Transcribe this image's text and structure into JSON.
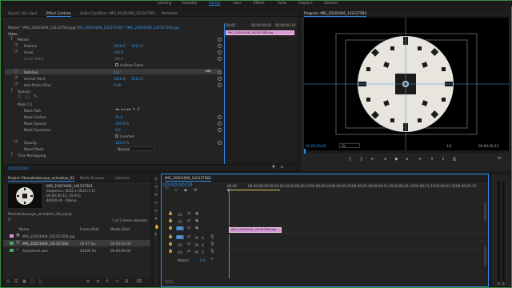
{
  "workspaces": [
    "Learning",
    "Assembly",
    "Editing",
    "Color",
    "Effects",
    "Audio",
    "Graphics",
    "Libraries"
  ],
  "active_workspace": "Editing",
  "source_panel": {
    "tabs": [
      "Source: (no clips)",
      "Effect Controls",
      "Audio Clip Mixer: IMG_20201006_142337583",
      "Metadata"
    ],
    "active_tab": "Effect Controls",
    "master_label": "Master * IMG_20201006_142337583.jpg",
    "sequence_label": "IMG_20201006_142337583 * IMG_20201006_142337583.jpg",
    "clip_label": "IMG_20201006_142337583.jpg",
    "ruler_times": [
      "00;00",
      "00;00;00;05",
      "00;00;00;10"
    ],
    "video_header": "Video",
    "motion": "Motion",
    "position_label": "Position",
    "position_x": "2016.0",
    "position_y": "1512.0",
    "scale_label": "Scale",
    "scale_value": "100.0",
    "scale_width_label": "Scale Width",
    "scale_width_value": "100.0",
    "uniform_scale": "Uniform Scale",
    "rotation_label": "Rotation",
    "rotation_value": "0.0 °",
    "anchor_label": "Anchor Point",
    "anchor_x": "2016.0",
    "anchor_y": "1512.0",
    "antiflicker_label": "Anti-flicker Filter",
    "antiflicker_value": "0.00",
    "opacity_header": "Opacity",
    "mask_label": "Mask (1)",
    "mask_path": "Mask Path",
    "mask_feather": "Mask Feather",
    "mask_feather_value": "10.0",
    "mask_opacity": "Mask Opacity",
    "mask_opacity_value": "100.0 %",
    "mask_expansion": "Mask Expansion",
    "mask_expansion_value": "0.0",
    "inverted": "Inverted",
    "opacity_label": "Opacity",
    "opacity_value": "100.0 %",
    "blend_label": "Blend Mode",
    "blend_value": "Normal",
    "time_remap": "Time Remapping",
    "timecode": "00;00;00;00"
  },
  "program_monitor": {
    "title": "Program: IMG_20201006_142337583",
    "timecode": "00;00;00;00",
    "fit": "Fit",
    "quality": "1/2",
    "duration": "00;00;00;12"
  },
  "project_panel": {
    "tabs": [
      "Project: Phenakistoscope_animation_02",
      "Media Browser",
      "Libraries"
    ],
    "active_tab": "Project: Phenakistoscope_animation_02",
    "preview_name": "IMG_20201006_142337583",
    "preview_info1": "Sequence, 4032 x 3024 (1.0)",
    "preview_info2": "00;00;00;12, 29.97p",
    "preview_info3": "48000 Hz - Stereo",
    "project_file": "Phenakistoscope_animation_02.prproj",
    "selection": "1 of 3 items selected",
    "columns": [
      "Name",
      "Frame Rate",
      "Media Start"
    ],
    "rows": [
      {
        "name": "IMG_20201006_142337583.jpg",
        "rate": "",
        "start": "",
        "color": "#d79ad2"
      },
      {
        "name": "IMG_20201006_142337583",
        "rate": "29.97 fps",
        "start": "00;00;00;00",
        "color": "#3fae6a"
      },
      {
        "name": "Xylophone.wav",
        "rate": "44100 Hz",
        "start": "00:00:00:00",
        "color": "#3fae6a"
      }
    ]
  },
  "timeline": {
    "title": "IMG_20201006_142337583",
    "timecode": "00;00;00;00",
    "ruler": [
      "00;00",
      "00;00;00;05",
      "00;00;00;10",
      "00;00;00;15",
      "00;00;00;20",
      "00;00;00;25",
      "00;00;01;00",
      "00;00;01;05",
      "00;00;01;10",
      "00;00;01;15",
      "00;00;01;20",
      "00;00;01;25"
    ],
    "video_tracks": [
      "V3",
      "V2",
      "V1"
    ],
    "audio_tracks": [
      "A1",
      "A2",
      "A3"
    ],
    "master": "Master",
    "master_value": "0.0",
    "clip_name": "IMG_20201006_142337583.jpg"
  }
}
